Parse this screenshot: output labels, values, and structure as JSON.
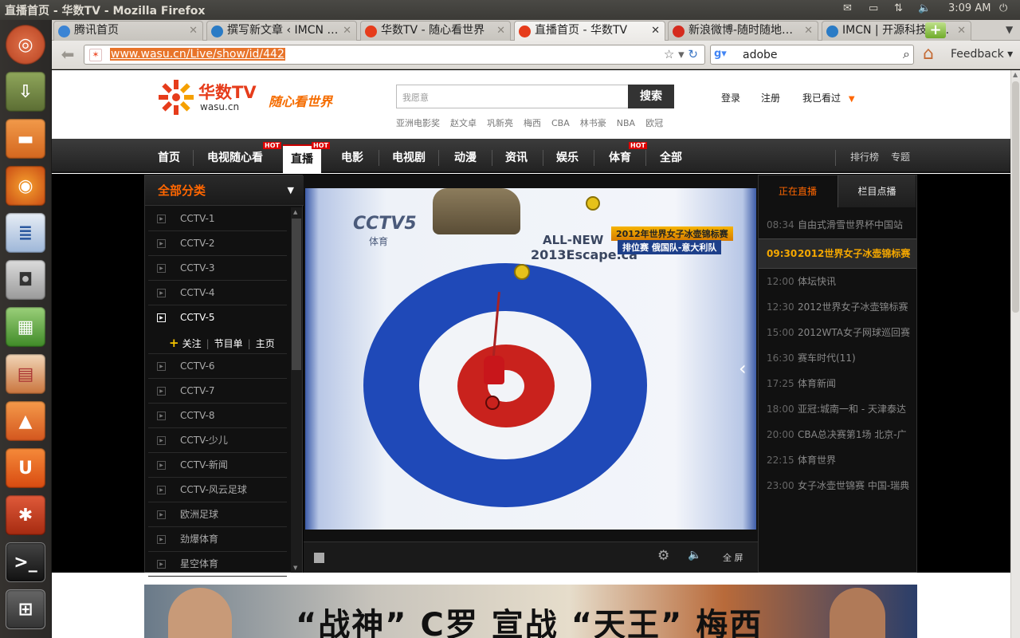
{
  "window_title": "直播首页 - 华数TV - Mozilla Firefox",
  "indicators": {
    "time": "3:09 AM"
  },
  "tabs": [
    {
      "label": "腾讯首页",
      "color": "#3b84d4"
    },
    {
      "label": "撰写新文章 ‹ IMCN …",
      "color": "#2a7bc5"
    },
    {
      "label": "华数TV - 随心看世界",
      "color": "#e63c1b"
    },
    {
      "label": "直播首页 - 华数TV",
      "color": "#e63c1b"
    },
    {
      "label": "新浪微博-随时随地…",
      "color": "#d52b1e"
    },
    {
      "label": "IMCN | 开源科技资…",
      "color": "#2a7bc5"
    }
  ],
  "url": "www.wasu.cn/Live/show/id/442",
  "search_engine_value": "adobe",
  "feedback_label": "Feedback",
  "site": {
    "logo_main": "华数TV",
    "logo_sub": "wasu.cn",
    "slogan": "随心看世界",
    "search_placeholder": "我愿意",
    "search_button": "搜索",
    "hotwords": [
      "亚洲电影奖",
      "赵文卓",
      "巩新亮",
      "梅西",
      "CBA",
      "林书豪",
      "NBA",
      "欧冠"
    ],
    "login": "登录",
    "register": "注册",
    "history": "我已看过",
    "nav": [
      "首页",
      "电视随心看",
      "直播",
      "电影",
      "电视剧",
      "动漫",
      "资讯",
      "娱乐",
      "体育",
      "全部"
    ],
    "hot_badge": "HOT",
    "nav_right": [
      "排行榜",
      "专题"
    ]
  },
  "categories": {
    "header": "全部分类",
    "items": [
      "CCTV-1",
      "CCTV-2",
      "CCTV-3",
      "CCTV-4",
      "CCTV-5",
      "CCTV-6",
      "CCTV-7",
      "CCTV-8",
      "CCTV-少儿",
      "CCTV-新闻",
      "CCTV-风云足球",
      "欧洲足球",
      "劲爆体育",
      "星空体育"
    ],
    "active": "CCTV-5",
    "sub_actions": [
      "关注",
      "节目单",
      "主页"
    ]
  },
  "video": {
    "channel_logo": "CCTV5",
    "channel_sub": "体育",
    "ad_line1": "ALL-NEW",
    "ad_line2": "2013Escape.ca",
    "caption_line1": "2012年世界女子冰壶锦标赛",
    "caption_line2": "排位赛 俄国队-意大利队",
    "fullscreen": "全 屏"
  },
  "schedule": {
    "tab_live": "正在直播",
    "tab_vod": "栏目点播",
    "items": [
      {
        "time": "08:34",
        "title": "自由式滑雪世界杯中国站"
      },
      {
        "time": "09:30",
        "title": "2012世界女子冰壶锦标赛"
      },
      {
        "time": "12:00",
        "title": "体坛快讯"
      },
      {
        "time": "12:30",
        "title": "2012世界女子冰壶锦标赛"
      },
      {
        "time": "15:00",
        "title": "2012WTA女子网球巡回赛"
      },
      {
        "time": "16:30",
        "title": "赛车时代(11)"
      },
      {
        "time": "17:25",
        "title": "体育新闻"
      },
      {
        "time": "18:00",
        "title": "亚冠:城南一和 - 天津泰达"
      },
      {
        "time": "20:00",
        "title": "CBA总决赛第1场 北京-广"
      },
      {
        "time": "22:15",
        "title": "体育世界"
      },
      {
        "time": "23:00",
        "title": "女子冰壶世锦赛 中国-瑞典"
      }
    ],
    "current_index": 1
  },
  "banner_text": "“战神” C罗 宣战 “天王” 梅西",
  "colors": {
    "accent": "#f60",
    "nav_bg": "#2b2b2b",
    "now_playing": "#f5a800",
    "hot": "#d00"
  }
}
